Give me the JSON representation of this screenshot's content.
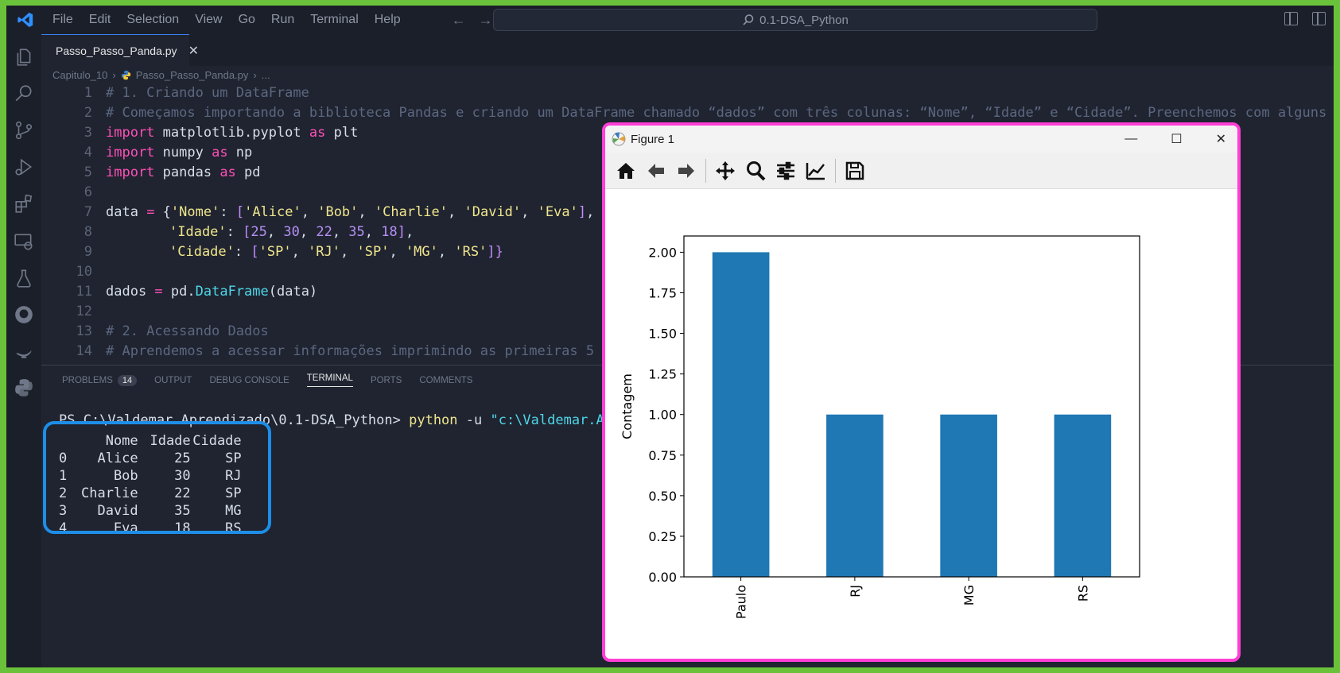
{
  "menu": [
    "File",
    "Edit",
    "Selection",
    "View",
    "Go",
    "Run",
    "Terminal",
    "Help"
  ],
  "command_center": "0.1-DSA_Python",
  "tab": {
    "label": "Passo_Passo_Panda.py",
    "close": "✕"
  },
  "breadcrumb": {
    "folder": "Capitulo_10",
    "file": "Passo_Passo_Panda.py",
    "more": "..."
  },
  "editor": {
    "line_numbers": [
      "1",
      "2",
      "3",
      "4",
      "5",
      "6",
      "7",
      "8",
      "9",
      "10",
      "11",
      "12",
      "13",
      "14"
    ],
    "l1": "# 1. Criando um DataFrame",
    "l2": "# Começamos importando a biblioteca Pandas e criando um DataFrame chamado “dados” com três colunas: “Nome”, “Idade” e “Cidade”. Preenchemos com alguns",
    "l3": {
      "kw": "import",
      "mod": " matplotlib.pyplot ",
      "as": "as",
      "alias": " plt"
    },
    "l4": {
      "kw": "import",
      "mod": " numpy ",
      "as": "as",
      "alias": " np"
    },
    "l5": {
      "kw": "import",
      "mod": " pandas ",
      "as": "as",
      "alias": " pd"
    },
    "l7": {
      "a": "data ",
      "eq": "=",
      "b": " {",
      "k": "'Nome'",
      "c": ": ",
      "br": "[",
      "v1": "'Alice'",
      "v2": "'Bob'",
      "v3": "'Charlie'",
      "v4": "'David'",
      "v5": "'Eva'",
      "bc": "]",
      "end": ","
    },
    "l8": {
      "k": "'Idade'",
      "c": ": ",
      "br": "[",
      "n1": "25",
      "n2": "30",
      "n3": "22",
      "n4": "35",
      "n5": "18",
      "bc": "]",
      "end": ","
    },
    "l9": {
      "k": "'Cidade'",
      "c": ": ",
      "br": "[",
      "v1": "'SP'",
      "v2": "'RJ'",
      "v3": "'SP'",
      "v4": "'MG'",
      "v5": "'RS'",
      "bc": "]",
      "end": "}"
    },
    "l11": {
      "a": "dados ",
      "eq": "=",
      "b": " pd.",
      "fn": "DataFrame",
      "c": "(data)"
    },
    "l13": "# 2. Acessando Dados",
    "l14": "# Aprendemos a acessar informações imprimindo as primeiras 5"
  },
  "panel": {
    "tabs": [
      "PROBLEMS",
      "OUTPUT",
      "DEBUG CONSOLE",
      "TERMINAL",
      "PORTS",
      "COMMENTS"
    ],
    "problems_count": "14",
    "active_tab": "TERMINAL"
  },
  "terminal": {
    "prompt": "PS C:\\Valdemar.Aprendizado\\0.1-DSA_Python> ",
    "command": "python",
    "flag": " -u ",
    "path": "\"c:\\Valdemar.Apr",
    "columns": [
      "",
      "Nome",
      "Idade",
      "Cidade"
    ],
    "rows": [
      [
        "0",
        "Alice",
        "25",
        "SP"
      ],
      [
        "1",
        "Bob",
        "30",
        "RJ"
      ],
      [
        "2",
        "Charlie",
        "22",
        "SP"
      ],
      [
        "3",
        "David",
        "35",
        "MG"
      ],
      [
        "4",
        "Eva",
        "18",
        "RS"
      ]
    ]
  },
  "figure": {
    "title": "Figure 1",
    "controls": {
      "minimize": "—",
      "maximize": "☐",
      "close": "✕"
    }
  },
  "chart_data": {
    "type": "bar",
    "categories": [
      "Paulo",
      "RJ",
      "MG",
      "RS"
    ],
    "values": [
      2.0,
      1.0,
      1.0,
      1.0
    ],
    "title": "",
    "xlabel": "",
    "ylabel": "Contagem",
    "ylim": [
      0,
      2.1
    ],
    "yticks": [
      "0.00",
      "0.25",
      "0.50",
      "0.75",
      "1.00",
      "1.25",
      "1.50",
      "1.75",
      "2.00"
    ],
    "bar_color": "#1f77b4",
    "grid": false
  },
  "colors": {
    "figure_border": "#ff3fd6",
    "dataframe_box": "#1d8ee8",
    "page_border": "#6ac23a"
  }
}
